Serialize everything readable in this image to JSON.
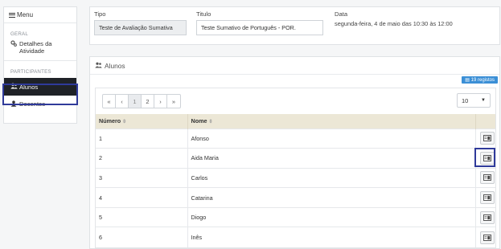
{
  "sidebar": {
    "menu_label": "Menu",
    "section_geral": "GERAL",
    "item_detalhes": "Detalhes da Atividade",
    "section_participantes": "PARTICIPANTES",
    "item_alunos": "Alunos",
    "item_docentes": "Docentes"
  },
  "info": {
    "tipo_label": "Tipo",
    "tipo_value": "Teste de Avaliação Sumativa",
    "titulo_label": "Titulo",
    "titulo_value": "Teste Sumativo de Português - POR.",
    "data_label": "Data",
    "data_value": "segunda-feira, 4 de maio das 10:30 às 12:00"
  },
  "alunos": {
    "title": "Alunos",
    "badge": "19 registos",
    "pagination": [
      "«",
      "‹",
      "1",
      "2",
      "›",
      "»"
    ],
    "current_page": "1",
    "page_size": "10",
    "columns": [
      "Número",
      "Nome"
    ],
    "rows": [
      {
        "numero": "1",
        "nome": "Afonso"
      },
      {
        "numero": "2",
        "nome": "Aida Maria"
      },
      {
        "numero": "3",
        "nome": "Carlos"
      },
      {
        "numero": "4",
        "nome": "Catarina"
      },
      {
        "numero": "5",
        "nome": "Diogo"
      },
      {
        "numero": "6",
        "nome": "Inês"
      }
    ]
  },
  "icons": {
    "menu": "hamburger-icon",
    "detalhes": "cogs-icon",
    "alunos": "users-icon",
    "docentes": "user-icon",
    "row_action": "id-card-icon"
  },
  "colors": {
    "active_bg": "#1f2227",
    "table_header_bg": "#ece7d6",
    "badge_bg": "#3b8fd6",
    "highlight": "#2f3a9a"
  }
}
